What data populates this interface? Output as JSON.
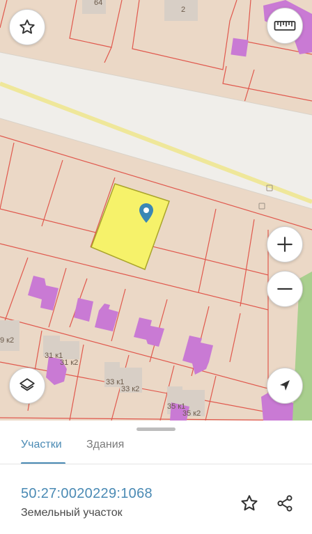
{
  "map": {
    "house_labels": [
      {
        "id": "64",
        "text": "64"
      },
      {
        "id": "2",
        "text": "2"
      },
      {
        "id": "29k2",
        "text": "9 к2"
      },
      {
        "id": "31k1",
        "text": "31 к1"
      },
      {
        "id": "31k2",
        "text": "31 к2"
      },
      {
        "id": "33k1",
        "text": "33 к1"
      },
      {
        "id": "33k2",
        "text": "33 к2"
      },
      {
        "id": "35k1",
        "text": "35 к1"
      },
      {
        "id": "35k2",
        "text": "35 к2"
      }
    ],
    "colors": {
      "background": "#ebd8c6",
      "road": "#f0eeea",
      "road_center_line": "#efe79a",
      "parcel_border": "#e0584d",
      "building": "#c97ad4",
      "building_gray": "#d8cfc6",
      "selected_parcel": "#f6f26a",
      "selected_border": "#a9a42a",
      "pin": "#3a87b5"
    }
  },
  "controls": {
    "favorite_icon": "star-outline-icon",
    "ruler_icon": "ruler-icon",
    "zoom_in_icon": "plus-icon",
    "zoom_out_icon": "minus-icon",
    "layers_icon": "layers-icon",
    "locate_icon": "navigation-arrow-icon"
  },
  "panel": {
    "tabs": [
      {
        "label": "Участки",
        "active": true
      },
      {
        "label": "Здания",
        "active": false
      }
    ],
    "cadastral_number": "50:27:0020229:1068",
    "object_type": "Земельный участок",
    "actions": {
      "favorite_icon": "star-outline-icon",
      "share_icon": "share-icon"
    },
    "accent_color": "#4a8ab4"
  }
}
